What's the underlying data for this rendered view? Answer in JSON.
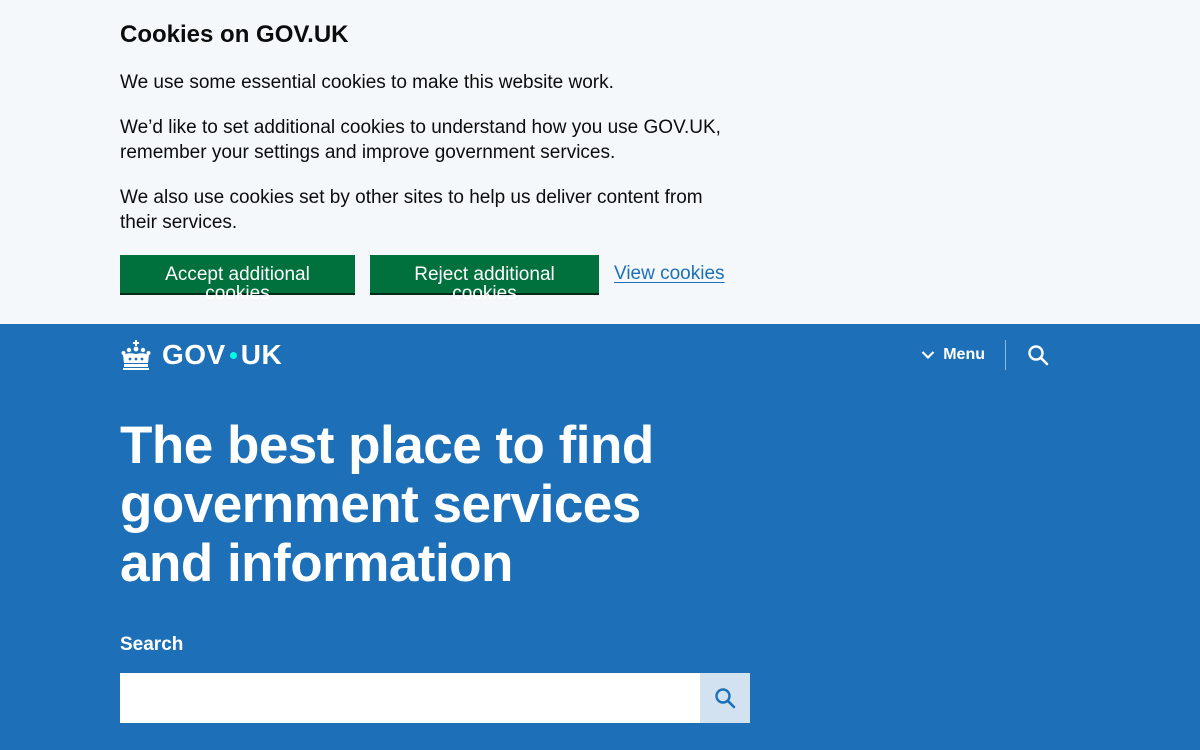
{
  "cookie_banner": {
    "heading": "Cookies on GOV.UK",
    "paragraph1": "We use some essential cookies to make this website work.",
    "paragraph2": "We’d like to set additional cookies to understand how you use GOV.UK, remember your settings and improve government services.",
    "paragraph3": "We also use cookies set by other sites to help us deliver content from their services.",
    "accept_label": "Accept additional cookies",
    "reject_label": "Reject additional cookies",
    "view_label": "View cookies"
  },
  "header": {
    "logo_left": "GOV",
    "logo_right": "UK",
    "logo_icon": "crown-icon",
    "menu_label": "Menu",
    "menu_icon": "chevron-down-icon",
    "search_icon": "search-icon"
  },
  "hero": {
    "title": "The best place to find government services and information",
    "search_label": "Search",
    "search_value": "",
    "search_submit_icon": "search-icon"
  },
  "colors": {
    "banner_bg": "#f4f8fb",
    "brand_blue": "#1d70b8",
    "button_green": "#00703c",
    "link_blue": "#1d70b8",
    "logo_dot": "#00ffe0",
    "search_button_bg": "#d2e2f1"
  }
}
